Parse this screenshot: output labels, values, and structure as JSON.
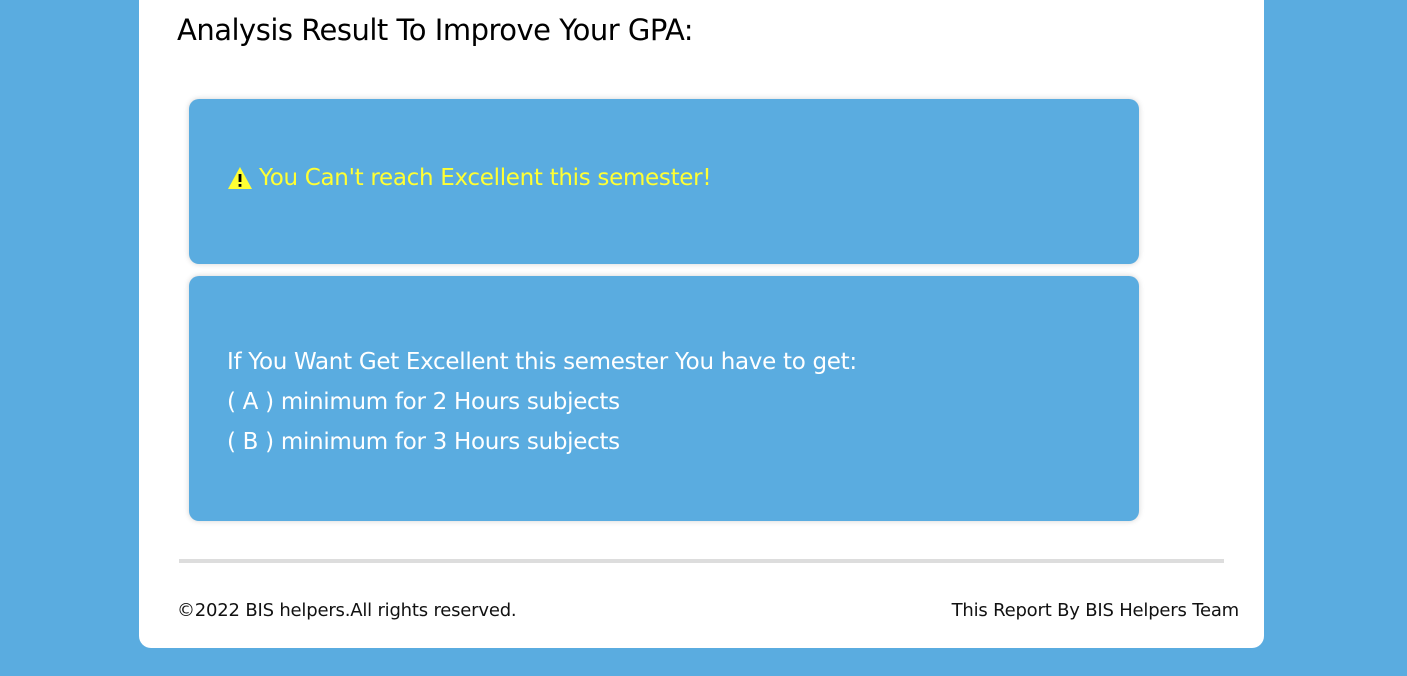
{
  "report": {
    "title": "Analysis Result To Improve Your GPA:",
    "warning": {
      "icon": "warning-icon",
      "text": "You Can't reach Excellent this semester!",
      "color": "#ffff33"
    },
    "advice": {
      "intro": "If You Want Get Excellent this semester You have to get:",
      "lines": [
        "( A ) minimum for 2 Hours subjects",
        "( B ) minimum for 3 Hours subjects"
      ]
    }
  },
  "footer": {
    "copyright": "©2022 BIS helpers.All rights reserved.",
    "credit": "This Report By BIS Helpers Team"
  },
  "colors": {
    "background": "#5aace0",
    "card": "#ffffff",
    "box": "#5aace0"
  }
}
